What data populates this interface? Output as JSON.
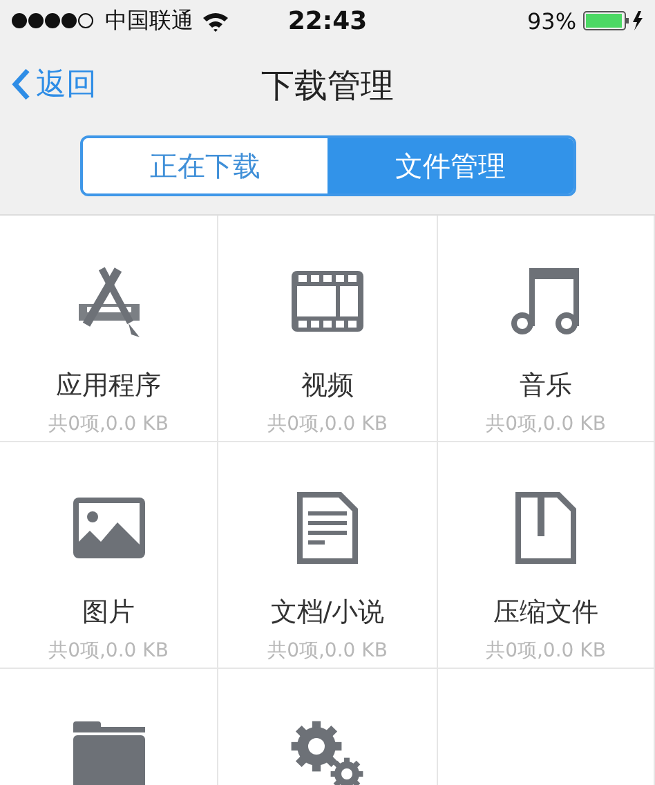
{
  "status_bar": {
    "carrier": "中国联通",
    "time": "22:43",
    "battery": "93%"
  },
  "nav": {
    "back": "返回",
    "title": "下载管理"
  },
  "segments": [
    {
      "label": "正在下载",
      "selected": false
    },
    {
      "label": "文件管理",
      "selected": true
    }
  ],
  "categories": [
    {
      "kind": "apps",
      "name": "应用程序",
      "summary": "共0项,0.0 KB"
    },
    {
      "kind": "video",
      "name": "视频",
      "summary": "共0项,0.0 KB"
    },
    {
      "kind": "music",
      "name": "音乐",
      "summary": "共0项,0.0 KB"
    },
    {
      "kind": "image",
      "name": "图片",
      "summary": "共0项,0.0 KB"
    },
    {
      "kind": "document",
      "name": "文档/小说",
      "summary": "共0项,0.0 KB"
    },
    {
      "kind": "archive",
      "name": "压缩文件",
      "summary": "共0项,0.0 KB"
    },
    {
      "kind": "folder"
    },
    {
      "kind": "settings"
    }
  ]
}
